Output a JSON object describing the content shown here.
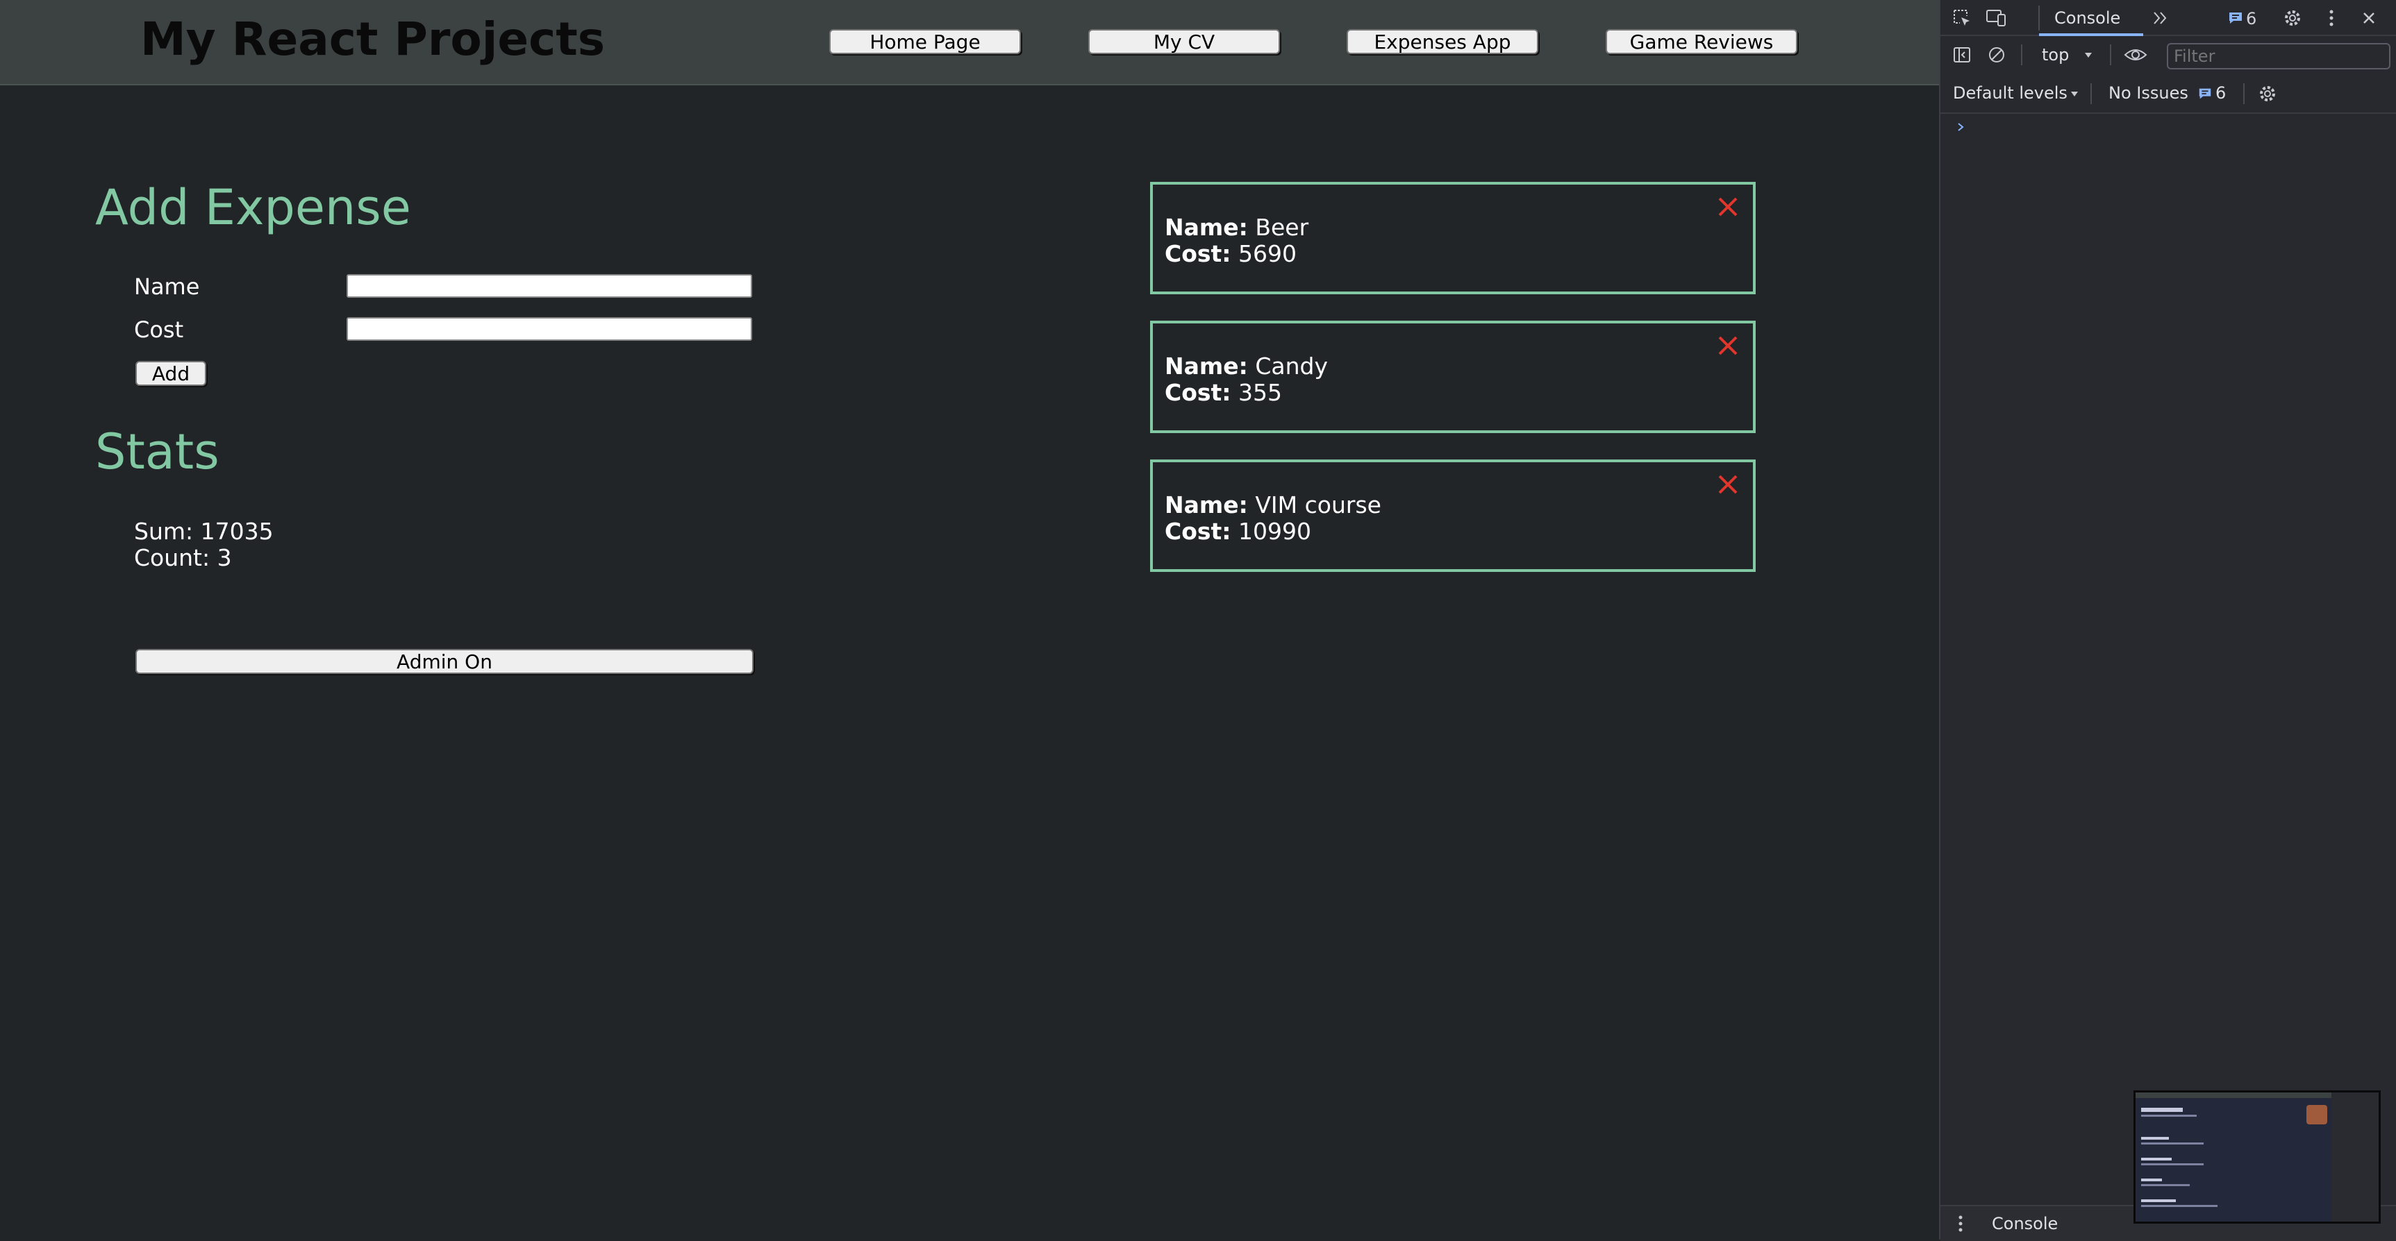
{
  "header": {
    "title": "My React Projects",
    "nav": [
      "Home Page",
      "My CV",
      "Expenses App",
      "Game Reviews"
    ]
  },
  "add_expense": {
    "heading": "Add Expense",
    "name_label": "Name",
    "cost_label": "Cost",
    "name_value": "",
    "cost_value": "",
    "add_button": "Add"
  },
  "stats": {
    "heading": "Stats",
    "sum_text": "Sum: 17035",
    "count_text": "Count: 3"
  },
  "admin_button": "Admin On",
  "expenses": [
    {
      "name_label": "Name:",
      "name": "Beer",
      "cost_label": "Cost:",
      "cost": "5690"
    },
    {
      "name_label": "Name:",
      "name": "Candy",
      "cost_label": "Cost:",
      "cost": "355"
    },
    {
      "name_label": "Name:",
      "name": "VIM course",
      "cost_label": "Cost:",
      "cost": "10990"
    }
  ],
  "devtools": {
    "active_tab": "Console",
    "message_count": "6",
    "context": "top",
    "filter_placeholder": "Filter",
    "levels": "Default levels",
    "issues": "No Issues",
    "issues_count": "6",
    "drawer_tab": "Console",
    "icons": [
      "inspect-icon",
      "device-icon",
      "more-tabs-icon",
      "messages-icon",
      "settings-icon",
      "kebab-icon",
      "close-icon",
      "sidebar-icon",
      "clear-icon",
      "eye-icon",
      "prompt-icon"
    ]
  },
  "colors": {
    "page_bg": "#212528",
    "header_bg": "#3c4242",
    "accent": "#82c9a3",
    "delete": "#e0362c",
    "devtools_bg": "#28282f"
  }
}
